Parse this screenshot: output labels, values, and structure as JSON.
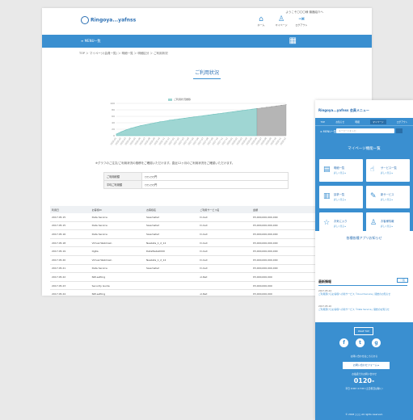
{
  "desktop": {
    "logo": "Ringoya...yafnss",
    "header_note": "ようこそ〇〇〇様 機器紹介ヘ",
    "header_icons": [
      {
        "name": "home-icon",
        "glyph": "⌂",
        "label": "ホーム"
      },
      {
        "name": "person-icon",
        "glyph": "♙",
        "label": "マイページ"
      },
      {
        "name": "logout-icon",
        "glyph": "⇥",
        "label": "ログアウト"
      }
    ],
    "nav_menu": "≡ MENU一覧",
    "breadcrumb": "TOP ＞ マイページ(会員一覧) ＞ 明細一覧 ＞ 明細区分 ＞ ご利用状況",
    "page_title": "ご利用状況",
    "chart_note": "※グラフのご注文/ご利用状況の推移をご確認いただけます。直近12ヶ月のご利用状況をご確認いただけます。",
    "summary": [
      {
        "key": "ご利用総額",
        "value": "○○,○○円"
      },
      {
        "key": "平均ご利用額",
        "value": "○○,○○円"
      }
    ],
    "table": {
      "headers": [
        "利用日",
        "お客様ID",
        "お客様名",
        "ご利用サービス名",
        "金額",
        "区分",
        "備考"
      ],
      "rows": [
        [
          "2017.05.15",
          "Data Service",
          "Ssssmats2",
          "D-Cell",
          "¥3,000,000,000,000",
          "Plsale",
          "\\0,000"
        ],
        [
          "2017.05.15",
          "Data Service",
          "Ssssmats2",
          "D-Cell",
          "¥3,000,000,000,000",
          "Plsale",
          "\\0,000"
        ],
        [
          "2017.05.16",
          "Data Service",
          "Ssssmats2",
          "D-Cell",
          "¥3,000,000,000,000",
          "Plsale",
          "\\0,000"
        ],
        [
          "2017.05.18",
          "Virtual Webmain",
          "Newlata_1_2_12",
          "D-Cell",
          "¥3,000,000,000,000",
          "Plsale",
          "\\10,000"
        ],
        [
          "2017.05.19",
          "OgKa",
          "DataWebs0000",
          "D-Cell",
          "¥3,000,000,000,000",
          "Plsale",
          "\\10,000"
        ],
        [
          "2017.05.20",
          "Virtual Webmain",
          "Newlata_1_2_12",
          "D-Cell",
          "¥3,000,000,000,000",
          "Plsale",
          "\\10,000"
        ],
        [
          "2017.05.21",
          "Data Service",
          "Ssssmats2",
          "D-Cell",
          "¥3,000,000,000,000",
          "Plsale",
          "\\7,000"
        ],
        [
          "2017.05.22",
          "NW-setting",
          "",
          "ol-Net",
          "¥3,000,000,000",
          "Plsale",
          "\\0,000"
        ],
        [
          "2017.05.23",
          "Security Guide",
          "",
          "",
          "¥3,000,000,000",
          "Off",
          "\\0,000"
        ],
        [
          "2017.05.24",
          "NW-setting",
          "",
          "ol-Net",
          "¥3,000,000,000",
          "Plsale",
          "\\0,000"
        ]
      ]
    }
  },
  "chart_data": {
    "type": "area",
    "legend": "ご利用状況推移",
    "x": [
      "2016.01",
      "2016.02",
      "2016.03",
      "2016.04",
      "2016.05",
      "2016.06",
      "2016.07",
      "2016.08",
      "2016.09",
      "2016.10",
      "2016.11",
      "2016.12",
      "2017.01",
      "2017.02",
      "2017.03",
      "2017.04",
      "2017.05",
      "2017.06",
      "2017.07",
      "2017.08",
      "2017.09",
      "2017.10",
      "2017.11",
      "2017.12",
      "2018.01",
      "2018.02",
      "2018.03",
      "2018.04",
      "2018.05",
      "2018.06",
      "2018.07",
      "2018.08",
      "2018.09",
      "2018.10",
      "2018.11",
      "2018.12"
    ],
    "values": [
      5,
      12,
      18,
      23,
      27,
      31,
      34,
      37,
      40,
      43,
      45,
      48,
      50,
      52,
      54,
      56,
      58,
      60,
      62,
      64,
      66,
      68,
      70,
      72,
      74,
      76,
      78,
      80,
      82,
      84,
      86,
      88,
      90,
      92,
      94,
      96
    ],
    "forecast_from_index": 29,
    "ylim": [
      0,
      100
    ],
    "yticks": [
      0,
      20,
      40,
      60,
      80,
      100
    ],
    "grid": true,
    "colors": {
      "area": "#9fd6d3",
      "line": "#6fc0bc",
      "forecast": "#b5b5b5"
    }
  },
  "mobile": {
    "logo": "Ringoya...yafnss 会員メニュー",
    "tabs": [
      "TOP",
      "お知らせ",
      "明細",
      "マイページ",
      "ログアウト"
    ],
    "menu_label": "≡ MENU一覧",
    "search_placeholder": "キーワードを入力",
    "section_title": "マイページ機能一覧",
    "cards": [
      {
        "icon": "document-icon",
        "glyph": "▤",
        "label": "明細一覧",
        "sub": "詳しく見る ▸"
      },
      {
        "icon": "hand-icon",
        "glyph": "☝",
        "label": "サービス一覧",
        "sub": "詳しく見る ▸"
      },
      {
        "icon": "list-icon",
        "glyph": "▥",
        "label": "請求一覧",
        "sub": "詳しく見る ▸"
      },
      {
        "icon": "register-icon",
        "glyph": "✎",
        "label": "新サービス",
        "sub": "詳しく見る ▸"
      },
      {
        "icon": "star-icon",
        "glyph": "☆",
        "label": "お気に入り",
        "sub": "詳しく見る ▸"
      },
      {
        "icon": "user-icon",
        "glyph": "♙",
        "label": "お客様情報",
        "sub": "詳しく見る ▸"
      }
    ],
    "news_title": "各種各種アプリお知らせ",
    "info_title": "最新情報",
    "more_label": "一覧",
    "news": [
      {
        "date": "2017.05.24",
        "text": "ご利用頂けるお客様への新サービス「Cloud Service」開始のお知らせ"
      },
      {
        "date": "2017.05.10",
        "text": "ご利用頂けるお客様への新サービス「Data Service」開始のお知らせ"
      }
    ],
    "footer": {
      "page_top": "PAGE TOP",
      "social": [
        "f",
        "t",
        "g"
      ],
      "contact_note": "お問い合わせはこちらから",
      "form_button": "お問い合わせフォーム ▸",
      "tel_note": "お電話でのお問い合わせ",
      "tel": "0120-",
      "hours": "平日 9:00～17:00 (土日祝日は除く)",
      "copyright": "© 2018 ○○○ All rights reserved."
    }
  }
}
